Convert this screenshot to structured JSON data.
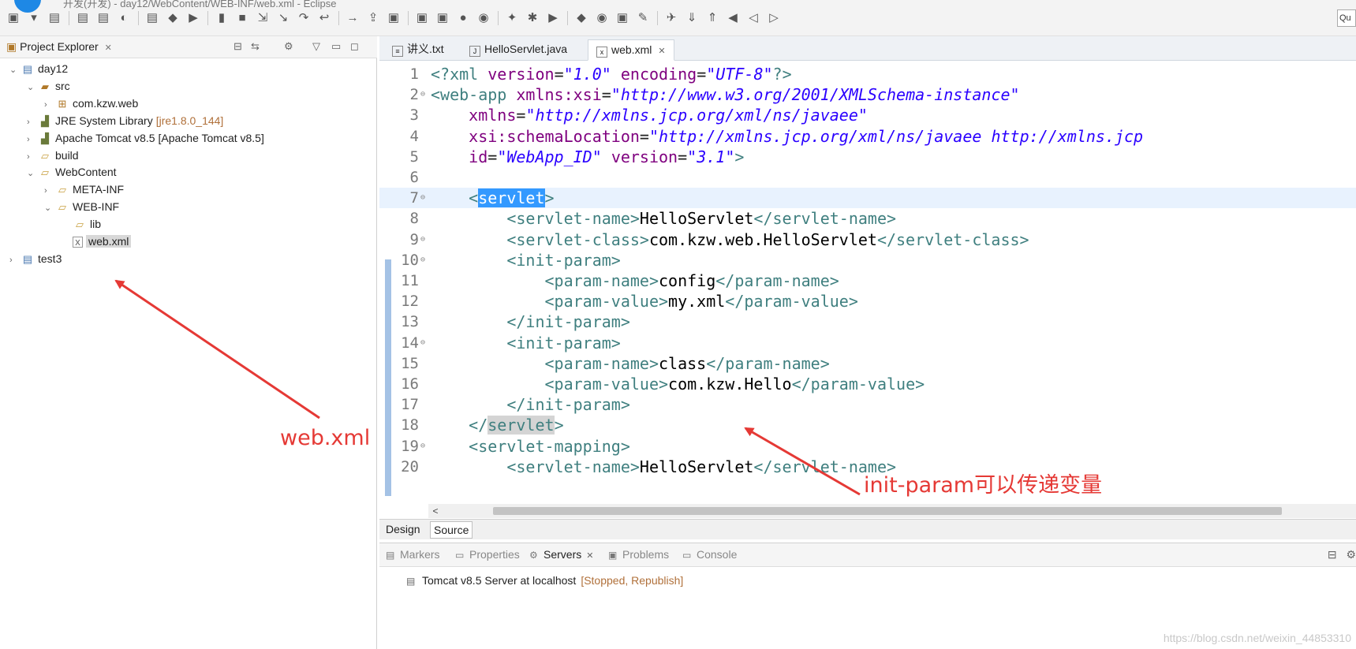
{
  "window": {
    "title": "开发(开发) - day12/WebContent/WEB-INF/web.xml - Eclipse"
  },
  "toolbar": {
    "icons": [
      "new-icon",
      "save-icon",
      "save-all-icon",
      "open-type-icon",
      "open-task-icon",
      "debug-run-icon",
      "terminal-icon",
      "skip-breakpoints-icon",
      "resume-icon",
      "suspend-icon",
      "terminate-icon",
      "disconnect-icon",
      "step-into-icon",
      "step-over-icon",
      "step-return-icon",
      "run-to-line-icon",
      "publish-icon",
      "new-server-icon",
      "new-java-project-icon",
      "new-package-icon",
      "new-class-icon",
      "globe-icon",
      "search-icon",
      "debug-icon",
      "run-icon",
      "external-tools-icon",
      "coverage-icon",
      "open-folder-icon",
      "edit-icon",
      "pin-icon",
      "next-annotation-icon",
      "prev-annotation-icon",
      "last-edit-icon",
      "back-icon",
      "forward-icon"
    ],
    "quick_access": "Qu"
  },
  "project_explorer": {
    "title": "Project Explorer",
    "tree": [
      {
        "label": "day12",
        "icon": "project-icon",
        "twisty": "open",
        "level": 0
      },
      {
        "label": "src",
        "icon": "source-folder-icon",
        "twisty": "open",
        "level": 1
      },
      {
        "label": "com.kzw.web",
        "icon": "package-icon",
        "twisty": "closed",
        "level": 2
      },
      {
        "label": "JRE System Library",
        "deco": "[jre1.8.0_144]",
        "icon": "library-icon",
        "twisty": "closed",
        "level": 1
      },
      {
        "label": "Apache Tomcat v8.5 [Apache Tomcat v8.5]",
        "icon": "library-icon",
        "twisty": "closed",
        "level": 1
      },
      {
        "label": "build",
        "icon": "folder-icon",
        "twisty": "closed",
        "level": 1
      },
      {
        "label": "WebContent",
        "icon": "folder-icon",
        "twisty": "open",
        "level": 1
      },
      {
        "label": "META-INF",
        "icon": "folder-icon",
        "twisty": "closed",
        "level": 2
      },
      {
        "label": "WEB-INF",
        "icon": "folder-icon",
        "twisty": "open",
        "level": 2
      },
      {
        "label": "lib",
        "icon": "folder-icon",
        "twisty": "none",
        "level": 3
      },
      {
        "label": "web.xml",
        "icon": "xml-file-icon",
        "twisty": "none",
        "level": 3,
        "selected": true
      },
      {
        "label": "test3",
        "icon": "project-icon",
        "twisty": "closed",
        "level": 0
      }
    ]
  },
  "editor": {
    "tabs": [
      {
        "label": "讲义.txt",
        "icon": "text-file-icon",
        "active": false
      },
      {
        "label": "HelloServlet.java",
        "icon": "java-file-icon",
        "active": false
      },
      {
        "label": "web.xml",
        "icon": "xml-file-icon",
        "active": true
      }
    ],
    "lines": [
      {
        "n": "1",
        "fold": false,
        "html": "<span class=\"t-pi\">&lt;?xml</span> <span class=\"t-attr\">version</span>=<span class=\"t-val\">\"1.0\"</span> <span class=\"t-attr\">encoding</span>=<span class=\"t-val\">\"UTF-8\"</span><span class=\"t-pi\">?&gt;</span>"
      },
      {
        "n": "2",
        "fold": true,
        "html": "<span class=\"t-tag\">&lt;web-app</span> <span class=\"t-attr\">xmlns:xsi</span>=<span class=\"t-val\">\"http://www.w3.org/2001/XMLSchema-instance\"</span>"
      },
      {
        "n": "3",
        "fold": false,
        "html": "    <span class=\"t-attr\">xmlns</span>=<span class=\"t-val\">\"http://xmlns.jcp.org/xml/ns/javaee\"</span>"
      },
      {
        "n": "4",
        "fold": false,
        "html": "    <span class=\"t-attr\">xsi:schemaLocation</span>=<span class=\"t-val\">\"http://xmlns.jcp.org/xml/ns/javaee http://xmlns.jcp</span>"
      },
      {
        "n": "5",
        "fold": false,
        "html": "    <span class=\"t-attr\">id</span>=<span class=\"t-val\">\"WebApp_ID\"</span> <span class=\"t-attr\">version</span>=<span class=\"t-val\">\"3.1\"</span><span class=\"t-tag\">&gt;</span>"
      },
      {
        "n": "6",
        "fold": false,
        "html": ""
      },
      {
        "n": "7",
        "fold": true,
        "current": true,
        "html": "    <span class=\"t-tag\">&lt;</span><span class=\"hl-sel\">servlet</span><span class=\"t-tag\">&gt;</span>"
      },
      {
        "n": "8",
        "fold": false,
        "html": "        <span class=\"t-tag\">&lt;servlet-name&gt;</span><span class=\"t-text\">HelloServlet</span><span class=\"t-tag\">&lt;/servlet-name&gt;</span>"
      },
      {
        "n": "9",
        "fold": true,
        "html": "        <span class=\"t-tag\">&lt;servlet-class&gt;</span><span class=\"t-text\">com.kzw.web.HelloServlet</span><span class=\"t-tag\">&lt;/servlet-class&gt;</span>"
      },
      {
        "n": "10",
        "fold": true,
        "html": "        <span class=\"t-tag\">&lt;init-param&gt;</span>"
      },
      {
        "n": "11",
        "fold": false,
        "html": "            <span class=\"t-tag\">&lt;param-name&gt;</span><span class=\"t-text\">config</span><span class=\"t-tag\">&lt;/param-name&gt;</span>"
      },
      {
        "n": "12",
        "fold": false,
        "html": "            <span class=\"t-tag\">&lt;param-value&gt;</span><span class=\"t-text\">my.xml</span><span class=\"t-tag\">&lt;/param-value&gt;</span>"
      },
      {
        "n": "13",
        "fold": false,
        "html": "        <span class=\"t-tag\">&lt;/init-param&gt;</span>"
      },
      {
        "n": "14",
        "fold": true,
        "html": "        <span class=\"t-tag\">&lt;init-param&gt;</span>"
      },
      {
        "n": "15",
        "fold": false,
        "html": "            <span class=\"t-tag\">&lt;param-name&gt;</span><span class=\"t-text\">class</span><span class=\"t-tag\">&lt;/param-name&gt;</span>"
      },
      {
        "n": "16",
        "fold": false,
        "html": "            <span class=\"t-tag\">&lt;param-value&gt;</span><span class=\"t-text\">com.kzw.Hello</span><span class=\"t-tag\">&lt;/param-value&gt;</span>"
      },
      {
        "n": "17",
        "fold": false,
        "html": "        <span class=\"t-tag\">&lt;/init-param&gt;</span>"
      },
      {
        "n": "18",
        "fold": false,
        "html": "    <span class=\"t-tag\">&lt;/</span><span class=\"hl-match t-tag\">servlet</span><span class=\"t-tag\">&gt;</span>"
      },
      {
        "n": "19",
        "fold": true,
        "html": "    <span class=\"t-tag\">&lt;servlet-mapping&gt;</span>"
      },
      {
        "n": "20",
        "fold": false,
        "html": "        <span class=\"t-tag\">&lt;servlet-name&gt;</span><span class=\"t-text\">HelloServlet</span><span class=\"t-tag\">&lt;/servlet-name&gt;</span>"
      }
    ],
    "bottom_tabs": {
      "design": "Design",
      "source": "Source"
    }
  },
  "bottom_panel": {
    "tabs": [
      {
        "label": "Markers",
        "icon": "markers-icon",
        "active": false
      },
      {
        "label": "Properties",
        "icon": "properties-icon",
        "active": false
      },
      {
        "label": "Servers",
        "icon": "servers-icon",
        "active": true
      },
      {
        "label": "Problems",
        "icon": "problems-icon",
        "active": false
      },
      {
        "label": "Console",
        "icon": "console-icon",
        "active": false
      }
    ],
    "server": {
      "name": "Tomcat v8.5 Server at localhost",
      "state": "[Stopped, Republish]"
    }
  },
  "annotations": {
    "left_label": "web.xml",
    "right_label": "init-param可以传递变量",
    "color": "#e53935"
  },
  "watermark": "https://blog.csdn.net/weixin_44853310"
}
